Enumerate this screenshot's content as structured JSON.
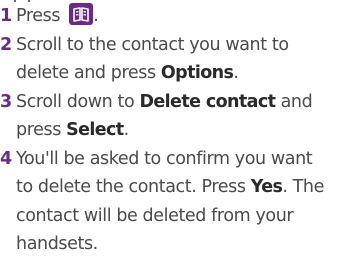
{
  "steps": [
    {
      "number": "1",
      "lines": [
        {
          "parts": [
            {
              "text": "Press "
            }
          ]
        }
      ],
      "icon": "phonebook-icon"
    },
    {
      "number": "2",
      "lines": [
        {
          "parts": [
            {
              "text": "Scroll to the contact you want to"
            }
          ]
        },
        {
          "parts": [
            {
              "text": "delete and press "
            },
            {
              "text": "Options",
              "strong": true
            },
            {
              "text": "."
            }
          ]
        }
      ]
    },
    {
      "number": "3",
      "lines": [
        {
          "parts": [
            {
              "text": "Scroll down to "
            },
            {
              "text": "Delete contact",
              "strong": true
            },
            {
              "text": " and"
            }
          ]
        },
        {
          "parts": [
            {
              "text": "press "
            },
            {
              "text": "Select",
              "strong": true
            },
            {
              "text": "."
            }
          ]
        }
      ]
    },
    {
      "number": "4",
      "lines": [
        {
          "parts": [
            {
              "text": "You'll be asked to confirm you want"
            }
          ]
        },
        {
          "parts": [
            {
              "text": "to delete the contact. Press "
            },
            {
              "text": "Yes",
              "strong": true
            },
            {
              "text": ". The"
            }
          ]
        },
        {
          "parts": [
            {
              "text": "contact will be deleted from your"
            }
          ]
        },
        {
          "parts": [
            {
              "text": "handsets."
            }
          ]
        }
      ]
    }
  ],
  "colors": {
    "accent": "#6b2a86",
    "text": "#4a4a4a",
    "strong_text": "#2a2a2a",
    "background": "#ffffff"
  }
}
